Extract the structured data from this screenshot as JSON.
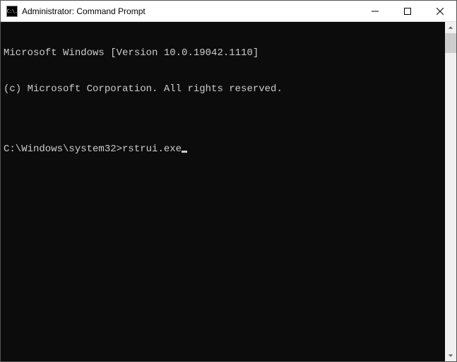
{
  "window": {
    "title": "Administrator: Command Prompt",
    "icon_label": "C:\\."
  },
  "terminal": {
    "line1": "Microsoft Windows [Version 10.0.19042.1110]",
    "line2": "(c) Microsoft Corporation. All rights reserved.",
    "blank": "",
    "prompt": "C:\\Windows\\system32>",
    "command": "rstrui.exe"
  }
}
